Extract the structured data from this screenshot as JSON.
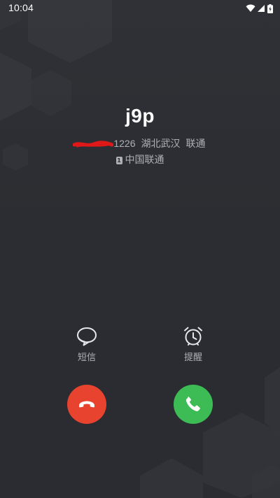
{
  "status_bar": {
    "time": "10:04"
  },
  "caller": {
    "name": "j9p",
    "number_suffix": "1226",
    "location": "湖北武汉",
    "network": "联通",
    "sim_slot": "1",
    "sim_carrier": "中国联通"
  },
  "actions": {
    "sms_label": "短信",
    "reminder_label": "提醒"
  },
  "icons": {
    "sms": "chat-bubble-icon",
    "reminder": "alarm-clock-icon",
    "decline": "phone-hangup-icon",
    "answer": "phone-answer-icon",
    "wifi": "wifi-icon",
    "signal": "signal-icon",
    "battery": "battery-charging-icon"
  },
  "colors": {
    "background": "#2c2e33",
    "decline": "#e8432f",
    "answer": "#3dbb55",
    "redaction": "#e01818",
    "secondary_text": "#aeb0b6"
  }
}
